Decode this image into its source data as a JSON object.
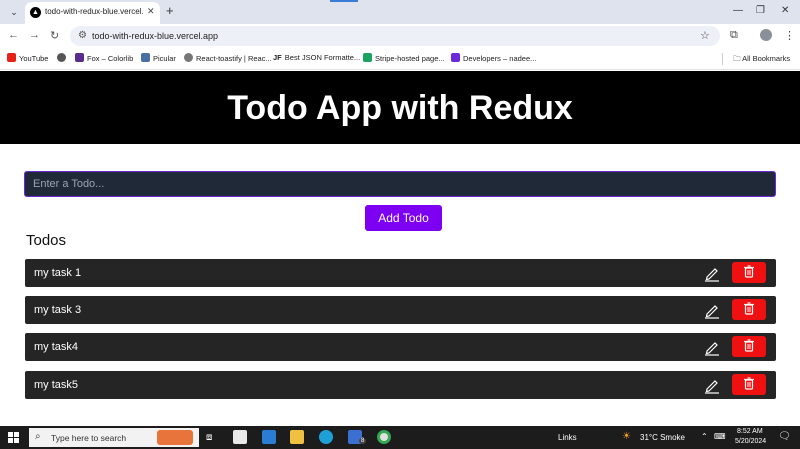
{
  "browser": {
    "tab_title": "todo-with-redux-blue.vercel.app",
    "url": "todo-with-redux-blue.vercel.app",
    "bookmarks": [
      {
        "label": "YouTube",
        "color": "#e62117"
      },
      {
        "label": "",
        "color": "#555555"
      },
      {
        "label": "Fox – Colorlib",
        "color": "#5a2d8c"
      },
      {
        "label": "Picular",
        "color": "#4a6fa5"
      },
      {
        "label": "React-toastify | Reac...",
        "color": "#777777"
      },
      {
        "label": "Best JSON Formatte...",
        "color": "#222222"
      },
      {
        "label": "Stripe-hosted page...",
        "color": "#1aa260"
      },
      {
        "label": "Developers – nadee...",
        "color": "#6c2bd9"
      }
    ],
    "bookmark_jf": "JF",
    "all_bookmarks": "All Bookmarks"
  },
  "app": {
    "title": "Todo App with Redux",
    "input_placeholder": "Enter a Todo...",
    "add_button": "Add Todo",
    "list_heading": "Todos",
    "todos": [
      "my task 1",
      "my task 3",
      "my task4",
      "my task5"
    ],
    "colors": {
      "banner": "#000000",
      "accent": "#7e00f2",
      "item_bg": "#252525",
      "delete": "#ef1111"
    }
  },
  "taskbar": {
    "search_placeholder": "Type here to search",
    "links": "Links",
    "weather": "31°C  Smoke",
    "time": "8:52 AM",
    "date": "5/20/2024",
    "badge": "8"
  }
}
